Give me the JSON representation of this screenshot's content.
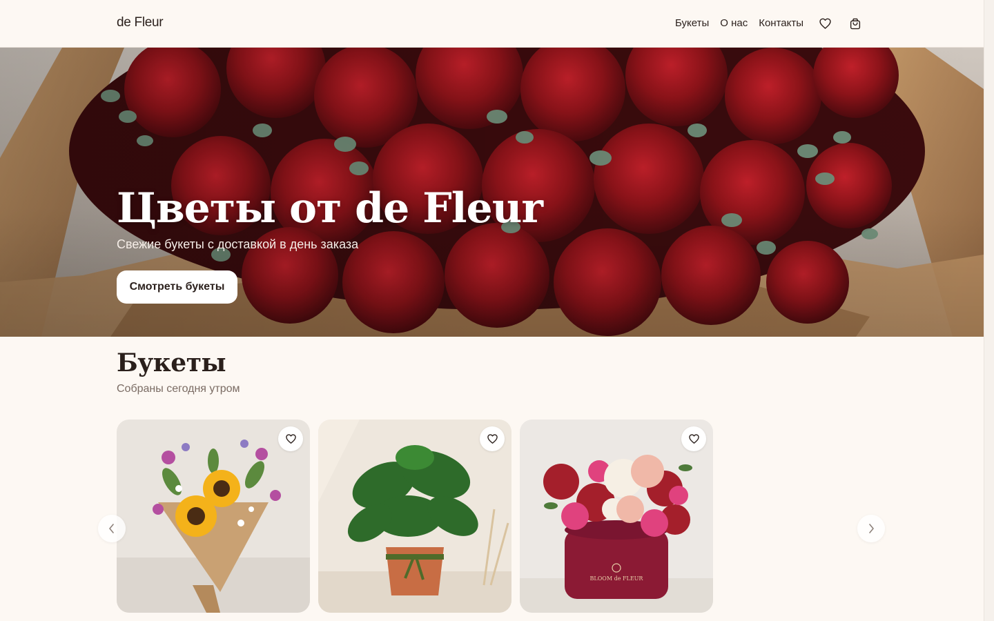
{
  "header": {
    "logo": "de Fleur",
    "nav": [
      "Букеты",
      "О нас",
      "Контакты"
    ],
    "icons": [
      "heart-icon",
      "shopping-bag-icon"
    ]
  },
  "hero": {
    "title": "Цветы от de Fleur",
    "subtitle": "Свежие букеты с доставкой в день заказа",
    "cta": "Смотреть букеты"
  },
  "section": {
    "title": "Букеты",
    "subtitle": "Собраны сегодня утром"
  },
  "cards": [
    {
      "image": "sunflower-bouquet"
    },
    {
      "image": "monstera-pot"
    },
    {
      "image": "flower-box",
      "box_text": "BLOOM de FLEUR"
    }
  ],
  "carousel": {
    "prev_icon": "chevron-left-icon",
    "next_icon": "chevron-right-icon"
  },
  "colors": {
    "background": "#fdf8f3",
    "text": "#2a1f1b",
    "muted": "#7a6b63",
    "rose": "#8b1a1f"
  }
}
